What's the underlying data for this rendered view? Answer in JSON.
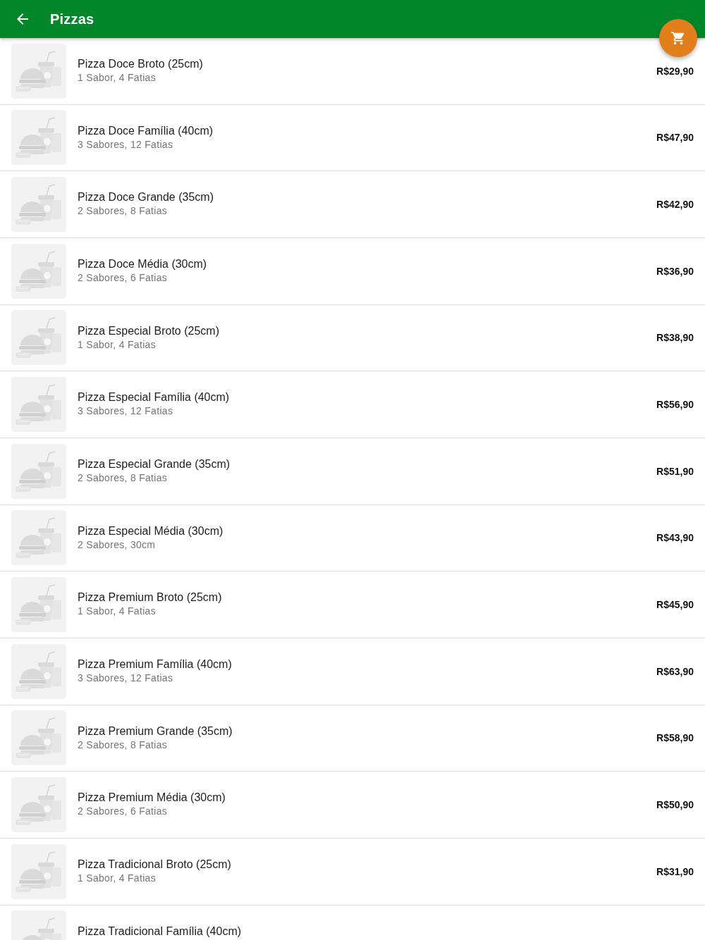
{
  "app_bar": {
    "title": "Pizzas"
  },
  "products": [
    {
      "name": "Pizza Doce Broto (25cm)",
      "description": "1 Sabor, 4 Fatias",
      "price": "R$29,90"
    },
    {
      "name": "Pizza Doce Família (40cm)",
      "description": "3 Sabores, 12 Fatias",
      "price": "R$47,90"
    },
    {
      "name": "Pizza Doce Grande (35cm)",
      "description": "2 Sabores, 8 Fatias",
      "price": "R$42,90"
    },
    {
      "name": "Pizza Doce Média (30cm)",
      "description": "2 Sabores, 6 Fatias",
      "price": "R$36,90"
    },
    {
      "name": "Pizza Especial Broto (25cm)",
      "description": "1 Sabor, 4 Fatias",
      "price": "R$38,90"
    },
    {
      "name": "Pizza Especial Família (40cm)",
      "description": "3 Sabores, 12 Fatias",
      "price": "R$56,90"
    },
    {
      "name": "Pizza Especial Grande (35cm)",
      "description": "2 Sabores, 8 Fatias",
      "price": "R$51,90"
    },
    {
      "name": "Pizza Especial Média (30cm)",
      "description": "2 Sabores, 30cm",
      "price": "R$43,90"
    },
    {
      "name": "Pizza Premium Broto (25cm)",
      "description": "1 Sabor, 4 Fatias",
      "price": "R$45,90"
    },
    {
      "name": "Pizza Premium Família (40cm)",
      "description": "3 Sabores, 12 Fatias",
      "price": "R$63,90"
    },
    {
      "name": "Pizza Premium Grande (35cm)",
      "description": "2 Sabores, 8 Fatias",
      "price": "R$58,90"
    },
    {
      "name": "Pizza Premium Média (30cm)",
      "description": "2 Sabores, 6 Fatias",
      "price": "R$50,90"
    },
    {
      "name": "Pizza Tradicional Broto (25cm)",
      "description": "1 Sabor, 4 Fatias",
      "price": "R$31,90"
    },
    {
      "name": "Pizza Tradicional Família (40cm)"
    }
  ]
}
